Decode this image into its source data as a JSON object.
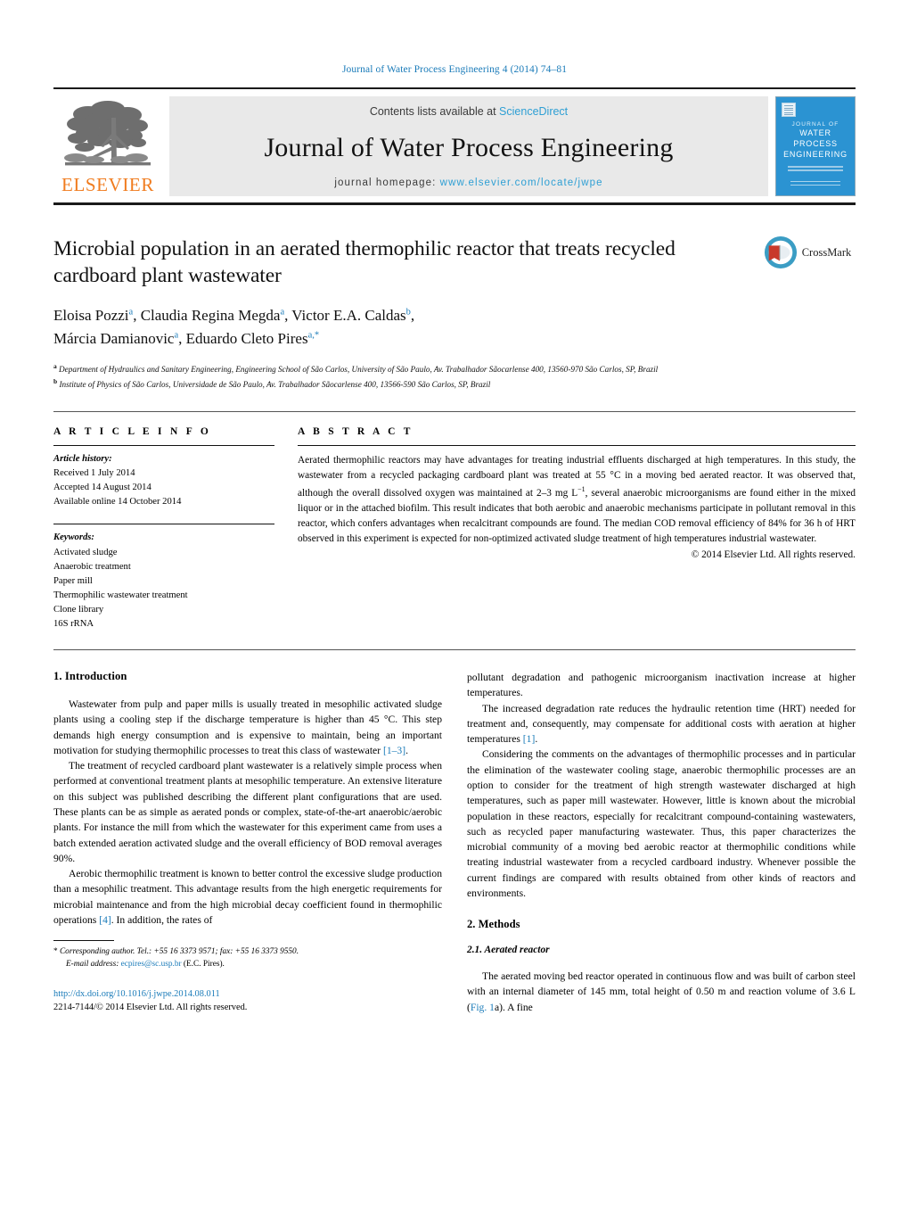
{
  "running_head": "Journal of Water Process Engineering 4 (2014) 74–81",
  "masthead": {
    "publisher_name": "ELSEVIER",
    "publisher_logo_icon": "elsevier-tree-icon",
    "contents_prefix": "Contents lists available at ",
    "contents_link": "ScienceDirect",
    "journal_title": "Journal of Water Process Engineering",
    "homepage_prefix": "journal homepage: ",
    "homepage_link": "www.elsevier.com/locate/jwpe",
    "cover": {
      "line1": "JOURNAL OF",
      "line2": "WATER PROCESS",
      "line3": "ENGINEERING",
      "bg_color": "#2b93d2"
    }
  },
  "article": {
    "title": "Microbial population in an aerated thermophilic reactor that treats recycled cardboard plant wastewater",
    "authors_line1_a": "Eloisa Pozzi",
    "authors_line1_a_sup": "a",
    "authors_line1_b": ", Claudia Regina Megda",
    "authors_line1_b_sup": "a",
    "authors_line1_c": ", Victor E.A. Caldas",
    "authors_line1_c_sup": "b",
    "authors_line1_d": ",",
    "authors_line2_a": "Márcia Damianovic",
    "authors_line2_a_sup": "a",
    "authors_line2_b": ", Eduardo Cleto Pires",
    "authors_line2_b_sup": "a,*",
    "affiliation_a_marker": "a",
    "affiliation_a": "Department of Hydraulics and Sanitary Engineering, Engineering School of São Carlos, University of São Paulo, Av. Trabalhador Sãocarlense 400, 13560-970 São Carlos, SP, Brazil",
    "affiliation_b_marker": "b",
    "affiliation_b": "Institute of Physics of São Carlos, Universidade de São Paulo, Av. Trabalhador Sãocarlense 400, 13566-590 São Carlos, SP, Brazil",
    "crossmark_label": "CrossMark",
    "crossmark_icon": "crossmark-logo-icon"
  },
  "article_info": {
    "section_label": "A R T I C L E   I N F O",
    "history_label": "Article history:",
    "history": [
      "Received 1 July 2014",
      "Accepted 14 August 2014",
      "Available online 14 October 2014"
    ],
    "keywords_label": "Keywords:",
    "keywords": [
      "Activated sludge",
      "Anaerobic treatment",
      "Paper mill",
      "Thermophilic wastewater treatment",
      "Clone library",
      "16S rRNA"
    ]
  },
  "abstract": {
    "section_label": "A B S T R A C T",
    "part1": "Aerated thermophilic reactors may have advantages for treating industrial effluents discharged at high temperatures. In this study, the wastewater from a recycled packaging cardboard plant was treated at 55 °C in a moving bed aerated reactor. It was observed that, although the overall dissolved oxygen was maintained at 2–3 mg L",
    "sup1": "−1",
    "part2": ", several anaerobic microorganisms are found either in the mixed liquor or in the attached biofilm. This result indicates that both aerobic and anaerobic mechanisms participate in pollutant removal in this reactor, which confers advantages when recalcitrant compounds are found. The median COD removal efficiency of 84% for 36 h of HRT observed in this experiment is expected for non-optimized activated sludge treatment of high temperatures industrial wastewater.",
    "copyright": "© 2014 Elsevier Ltd. All rights reserved."
  },
  "body": {
    "intro_heading": "1.  Introduction",
    "left_paragraphs": [
      {
        "text_a": "Wastewater from pulp and paper mills is usually treated in mesophilic activated sludge plants using a cooling step if the discharge temperature is higher than 45 °C. This step demands high energy consumption and is expensive to maintain, being an important motivation for studying thermophilic processes to treat this class of wastewater ",
        "ref": "[1–3]",
        "text_b": "."
      },
      {
        "text_a": "The treatment of recycled cardboard plant wastewater is a relatively simple process when performed at conventional treatment plants at mesophilic temperature. An extensive literature on this subject was published describing the different plant configurations that are used. These plants can be as simple as aerated ponds or complex, state-of-the-art anaerobic/aerobic plants. For instance the mill from which the wastewater for this experiment came from uses a batch extended aeration activated sludge and the overall efficiency of BOD removal averages 90%.",
        "ref": "",
        "text_b": ""
      },
      {
        "text_a": "Aerobic thermophilic treatment is known to better control the excessive sludge production than a mesophilic treatment. This advantage results from the high energetic requirements for microbial maintenance and from the high microbial decay coefficient found in thermophilic operations ",
        "ref": "[4]",
        "text_b": ". In addition, the rates of"
      }
    ],
    "right_paragraphs": [
      {
        "text_a": "pollutant degradation and pathogenic microorganism inactivation increase at higher temperatures.",
        "ref": "",
        "text_b": ""
      },
      {
        "text_a": "The increased degradation rate reduces the hydraulic retention time (HRT) needed for treatment and, consequently, may compensate for additional costs with aeration at higher temperatures ",
        "ref": "[1]",
        "text_b": "."
      },
      {
        "text_a": "Considering the comments on the advantages of thermophilic processes and in particular the elimination of the wastewater cooling stage, anaerobic thermophilic processes are an option to consider for the treatment of high strength wastewater discharged at high temperatures, such as paper mill wastewater. However, little is known about the microbial population in these reactors, especially for recalcitrant compound-containing wastewaters, such as recycled paper manufacturing wastewater. Thus, this paper characterizes the microbial community of a moving bed aerobic reactor at thermophilic conditions while treating industrial wastewater from a recycled cardboard industry. Whenever possible the current findings are compared with results obtained from other kinds of reactors and environments.",
        "ref": "",
        "text_b": ""
      }
    ],
    "methods_heading": "2.  Methods",
    "methods_subheading": "2.1.  Aerated reactor",
    "methods_para_a": "The aerated moving bed reactor operated in continuous flow and was built of carbon steel with an internal diameter of 145 mm, total height of 0.50 m and reaction volume of 3.6 L (",
    "methods_ref": "Fig. 1",
    "methods_para_b": "a). A fine"
  },
  "footnote": {
    "marker": "*",
    "corresponding": "Corresponding author. Tel.: +55 16 3373 9571; fax: +55 16 3373 9550.",
    "email_label": "E-mail address:",
    "email": "ecpires@sc.usp.br",
    "email_suffix": "(E.C. Pires).",
    "doi": "http://dx.doi.org/10.1016/j.jwpe.2014.08.011",
    "issn": "2214-7144/© 2014 Elsevier Ltd. All rights reserved."
  }
}
